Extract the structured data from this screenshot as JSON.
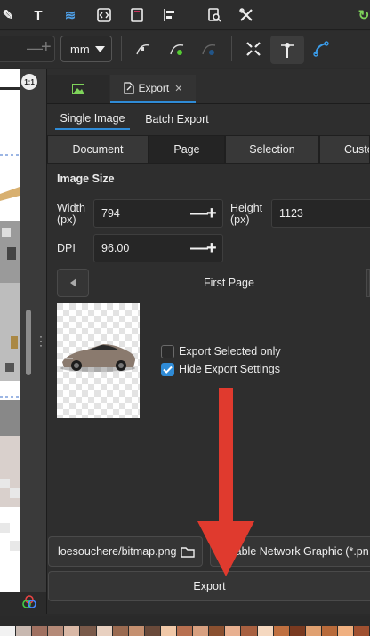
{
  "toolbar": {
    "units": "mm"
  },
  "canvas": {
    "zoom_badge": "1:1"
  },
  "dock": {
    "tabs": [
      {
        "label": ""
      },
      {
        "label": "Export"
      }
    ],
    "close_glyph": "✕",
    "subtabs": [
      "Single Image",
      "Batch Export"
    ],
    "area_modes": [
      "Document",
      "Page",
      "Selection",
      "Custo"
    ],
    "image_size_heading": "Image Size",
    "width_label": "Width\n(px)",
    "width_value": "794",
    "height_label": "Height\n(px)",
    "height_value": "1123",
    "dpi_label": "DPI",
    "dpi_value": "96.00",
    "page_nav_label": "First Page",
    "export_selected_only": "Export Selected only",
    "hide_export_settings": "Hide Export Settings",
    "filename": "loesouchere/bitmap.png",
    "format": "rtable Network Graphic (*.pn",
    "export_button": "Export"
  },
  "colors": {
    "accent": "#2f8bd6",
    "arrow": "#e03a2e"
  },
  "palette": [
    "#f2f2f2",
    "#c8b8b0",
    "#a07060",
    "#b58a78",
    "#d9b8a6",
    "#7a5a4a",
    "#e8d0c0",
    "#9a6a50",
    "#c59070",
    "#6a4a3a",
    "#f0c8a8",
    "#b87050",
    "#d8a080",
    "#8a5030",
    "#e8b090",
    "#a86040",
    "#f5d8c0",
    "#c07040",
    "#7a3a20",
    "#e0a070",
    "#b86a3a",
    "#f0b080",
    "#a05030"
  ]
}
